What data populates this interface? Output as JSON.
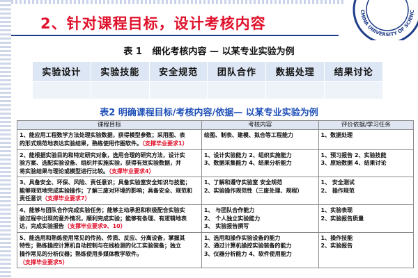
{
  "slide": {
    "title": "2、针对课程目标，设计考核内容"
  },
  "table1": {
    "caption_num": "表 1",
    "caption_text": "细化考核内容 — 以某专业实验为例",
    "headers": [
      "实验设计",
      "实验技能",
      "安全规范",
      "团队合作",
      "数据处理",
      "结果讨论"
    ]
  },
  "table2": {
    "caption": "表2 明确课程目标/考核内容/依据— 以某专业实验为例",
    "headers": [
      "课程目标",
      "考核内容",
      "评价依据/学习任务"
    ],
    "rows": [
      {
        "goal": [
          "1、能应用工程数学方法处理实验数据，获得模型参数；采用图、表",
          "的形式规范地表达实验结果，熟练使用作图软件。"
        ],
        "goal_req": "（支撑毕业要求1）",
        "content": [
          "绘图、制表、建模、拟合等工程能力"
        ],
        "basis": [
          "1、数据处理"
        ]
      },
      {
        "goal": [
          "2、能根据实验目的和特定研究对象，选用合理的研究方法，设计实",
          "验方案、选配实验设备、组织并实施实验，获得有效实验数据，并",
          "将实验结果与理论或模型进行比较。"
        ],
        "goal_req": "（支撑毕业要求4）",
        "content": [
          "1、设计实验能力    2、组织实施能力",
          "3、数据采集能力    4、结果分析能力"
        ],
        "basis": [
          "1、预习报告   2、实验技能",
          "3、原始数据   4、结果讨论"
        ]
      },
      {
        "goal": [
          "3、具备安全、环保、风险、责任意识；具备实验室安全知识与技能；",
          "能够规范地完成实验操作；了解三废对环境的影响；具备安全、规范和",
          "责任意识"
        ],
        "goal_req": "（支撑毕业要求7）",
        "content": [
          "1、了解和遵守实验室 安全规范",
          "2、实验操作规范性（三废处理、规程）"
        ],
        "basis": [
          "1、   安全测试",
          "2、   操作规范"
        ]
      },
      {
        "goal": [
          "4、能够与团队合作完成实验任务；能够主动承担和积极配合实验实",
          "验过程中出现的意外情况，顺利完成实验；能够有条理、有逻辑地表",
          "达，完成实验报告"
        ],
        "goal_req": "（支撑毕业要求9、10）",
        "content": [
          "1、   与团队合作能力",
          "2、   个人独立实验能力",
          "3、   实验报告撰写"
        ],
        "basis": [
          "1、实验表现",
          "2、实验报告质量"
        ]
      },
      {
        "goal": [
          "5、能选用和熟练使用常见的传热、传质、反应、分离设备，掌握其",
          "特性；熟练操控计算机自动控制与在线检测的化工实验装备；独立",
          "操作常见的分析仪器；熟练使用多媒体教学软件。"
        ],
        "goal_req": "（支撑毕业要求5）",
        "content": [
          "1、选用和操作实验设备的能力",
          "2、通过计算机操控实验装备的能力",
          "3、仪器分析能力  4、软件使用能力"
        ],
        "basis": [
          "1、操作技能",
          "2、实验报告"
        ]
      }
    ]
  },
  "logo": {
    "text": "CHINA UNIVERSITY OF SCIENCE AND TECH",
    "colors": {
      "ring": "#1f3c88",
      "fill": "#ffffff"
    }
  },
  "colors": {
    "title": "#e0102a",
    "caption2": "#1d4fb8",
    "table_header": "#dde6f4"
  }
}
